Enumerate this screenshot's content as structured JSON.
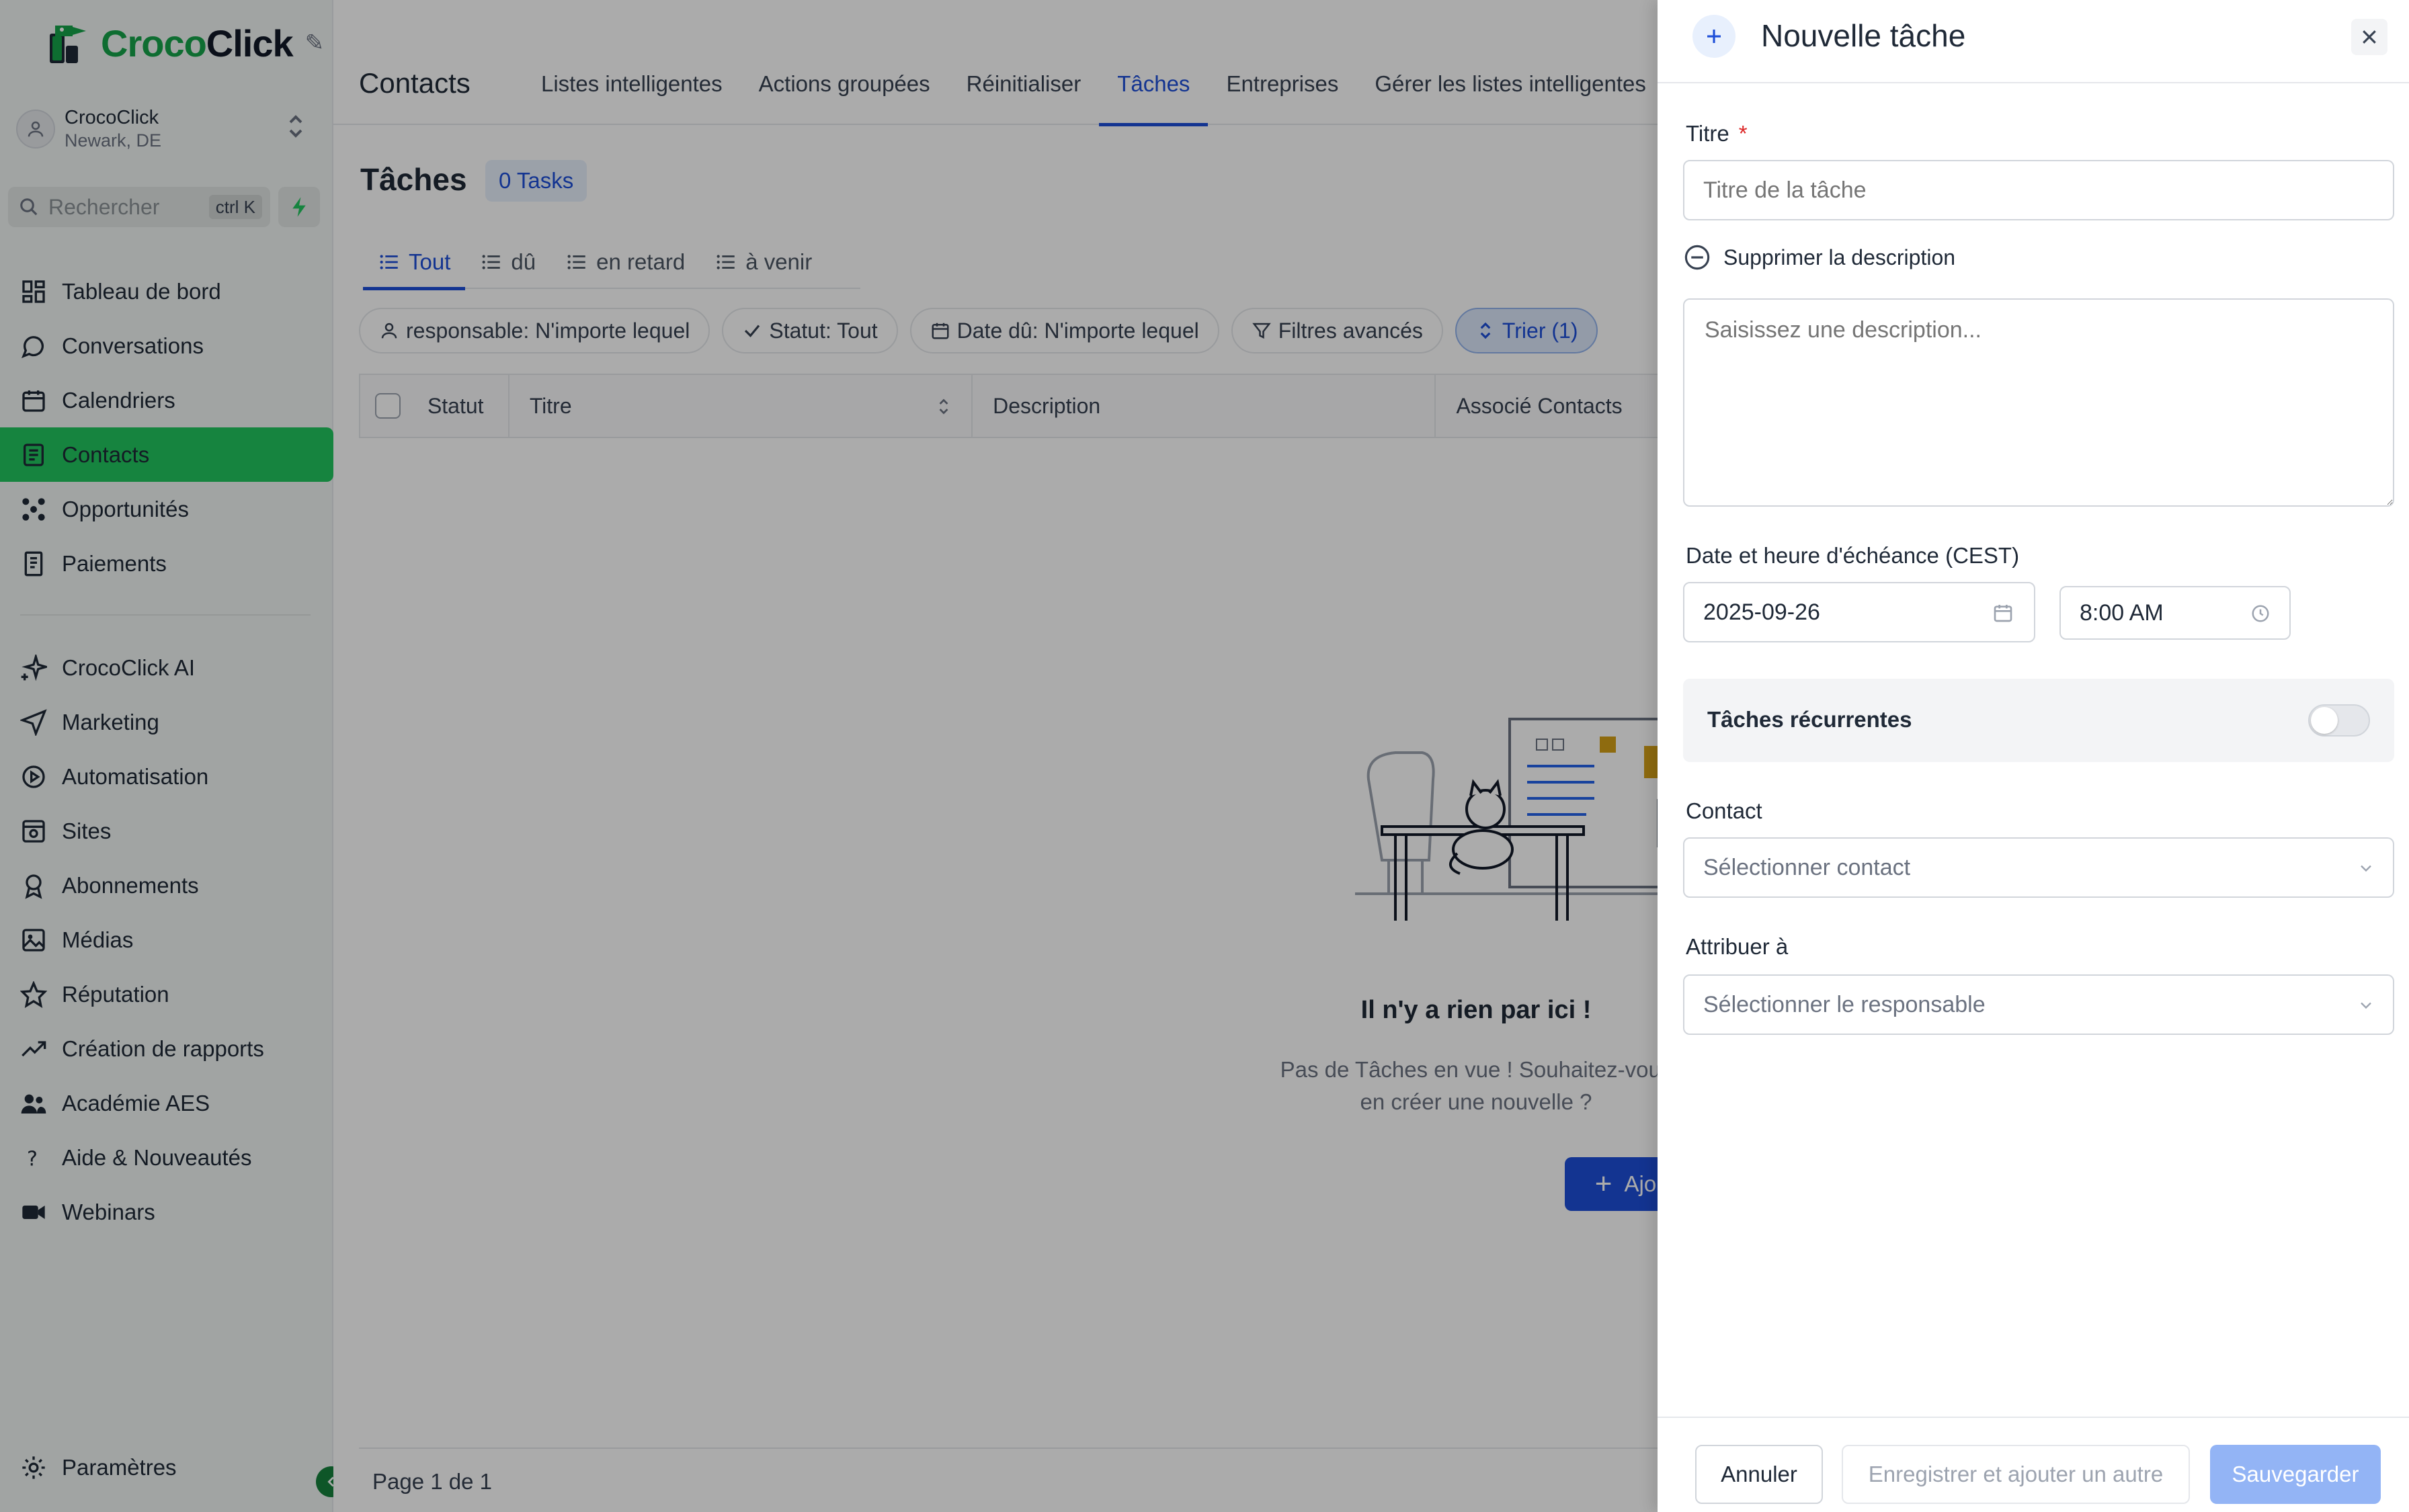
{
  "app": {
    "logo_text_a": "Croco",
    "logo_text_b": "Click",
    "account_name": "CrocoClick",
    "account_location": "Newark, DE"
  },
  "sidebar": {
    "search_placeholder": "Rechercher",
    "search_shortcut": "ctrl K",
    "items": [
      {
        "label": "Tableau de bord",
        "icon": "dashboard-icon"
      },
      {
        "label": "Conversations",
        "icon": "chat-icon"
      },
      {
        "label": "Calendriers",
        "icon": "calendar-icon"
      },
      {
        "label": "Contacts",
        "icon": "contacts-icon",
        "active": true
      },
      {
        "label": "Opportunités",
        "icon": "opportunities-icon"
      },
      {
        "label": "Paiements",
        "icon": "payments-icon"
      }
    ],
    "items2": [
      {
        "label": "CrocoClick AI",
        "icon": "sparkle-icon"
      },
      {
        "label": "Marketing",
        "icon": "send-icon"
      },
      {
        "label": "Automatisation",
        "icon": "automation-icon"
      },
      {
        "label": "Sites",
        "icon": "sites-icon"
      },
      {
        "label": "Abonnements",
        "icon": "badge-icon"
      },
      {
        "label": "Médias",
        "icon": "image-icon"
      },
      {
        "label": "Réputation",
        "icon": "star-icon"
      },
      {
        "label": "Création de rapports",
        "icon": "trend-icon"
      },
      {
        "label": "Académie AES",
        "icon": "users-icon"
      },
      {
        "label": "Aide & Nouveautés",
        "icon": "question-icon"
      },
      {
        "label": "Webinars",
        "icon": "video-icon"
      }
    ],
    "settings_label": "Paramètres"
  },
  "topbar": {
    "title": "Contacts",
    "tabs": [
      "Listes intelligentes",
      "Actions groupées",
      "Réinitialiser",
      "Tâches",
      "Entreprises",
      "Gérer les listes intelligentes"
    ],
    "active_tab": "Tâches"
  },
  "tasks": {
    "heading": "Tâches",
    "count": "0 Tasks",
    "subtabs": [
      "Tout",
      "dû",
      "en retard",
      "à venir"
    ],
    "filters": {
      "assignee": "responsable: N'importe lequel",
      "status": "Statut: Tout",
      "due": "Date dû: N'importe lequel",
      "advanced": "Filtres avancés",
      "sort": "Trier (1)"
    },
    "columns": [
      "Statut",
      "Titre",
      "Description",
      "Associé Contacts"
    ],
    "empty_title": "Il n'y a rien par ici !",
    "empty_sub_1": "Pas de Tâches en vue ! Souhaitez-vous",
    "empty_sub_2": "en créer une nouvelle ?",
    "add_button": "Ajouter une tâche",
    "pagination": "Page 1 de 1"
  },
  "drawer": {
    "title": "Nouvelle tâche",
    "title_label": "Titre",
    "title_required": "*",
    "title_placeholder": "Titre de la tâche",
    "remove_description": "Supprimer la description",
    "description_placeholder": "Saisissez une description...",
    "due_label": "Date et heure d'échéance (CEST)",
    "due_date": "2025-09-26",
    "due_time": "8:00 AM",
    "recurring_label": "Tâches récurrentes",
    "recurring_on": false,
    "contact_label": "Contact",
    "contact_placeholder": "Sélectionner contact",
    "assign_label": "Attribuer à",
    "assign_placeholder": "Sélectionner le responsable",
    "cancel": "Annuler",
    "save_and_add": "Enregistrer et ajouter un autre",
    "save": "Sauvegarder"
  },
  "colors": {
    "brand_green": "#22c55e",
    "primary_blue": "#1d4ed8",
    "required_red": "#dc2626"
  }
}
